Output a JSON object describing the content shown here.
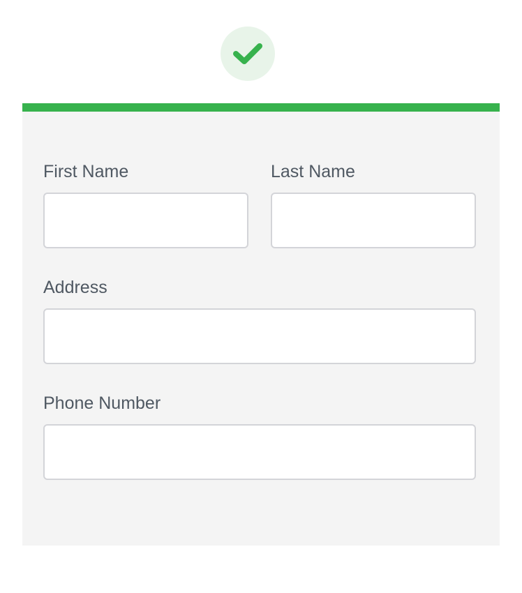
{
  "status_icon": {
    "name": "check-icon",
    "color": "#37b24d",
    "background": "#e8f4e9"
  },
  "accent_color": "#37b24d",
  "form": {
    "first_name": {
      "label": "First Name",
      "value": ""
    },
    "last_name": {
      "label": "Last Name",
      "value": ""
    },
    "address": {
      "label": "Address",
      "value": ""
    },
    "phone_number": {
      "label": "Phone Number",
      "value": ""
    }
  }
}
